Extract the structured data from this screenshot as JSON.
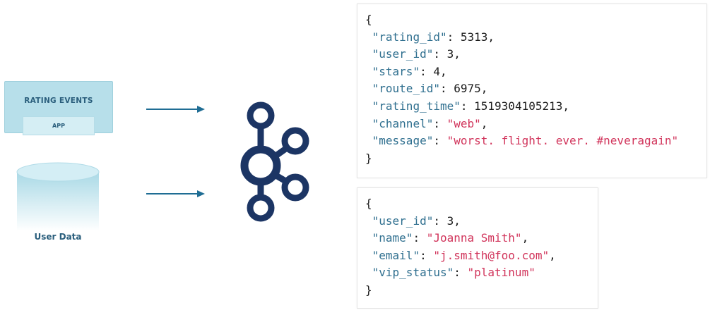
{
  "source": {
    "title": "RATING EVENTS",
    "tag": "APP"
  },
  "database": {
    "label": "User Data"
  },
  "logo": {
    "icon": "kafka-icon"
  },
  "rating_json": {
    "open": "{",
    "close": "}",
    "fields": [
      {
        "key": "\"rating_id\"",
        "value": "5313",
        "type": "number",
        "comma": ","
      },
      {
        "key": "\"user_id\"",
        "value": "3",
        "type": "number",
        "comma": ","
      },
      {
        "key": "\"stars\"",
        "value": "4",
        "type": "number",
        "comma": ","
      },
      {
        "key": "\"route_id\"",
        "value": "6975",
        "type": "number",
        "comma": ","
      },
      {
        "key": "\"rating_time\"",
        "value": "1519304105213",
        "type": "number",
        "comma": ","
      },
      {
        "key": "\"channel\"",
        "value": "\"web\"",
        "type": "string",
        "comma": ","
      },
      {
        "key": "\"message\"",
        "value": "\"worst. flight. ever. #neveragain\"",
        "type": "string",
        "comma": ""
      }
    ]
  },
  "user_json": {
    "open": "{",
    "close": "}",
    "fields": [
      {
        "key": "\"user_id\"",
        "value": "3",
        "type": "number",
        "comma": ","
      },
      {
        "key": "\"name\"",
        "value": "\"Joanna Smith\"",
        "type": "string",
        "comma": ","
      },
      {
        "key": "\"email\"",
        "value": "\"j.smith@foo.com\"",
        "type": "string",
        "comma": ","
      },
      {
        "key": "\"vip_status\"",
        "value": "\"platinum\"",
        "type": "string",
        "comma": ""
      }
    ]
  },
  "colors": {
    "key": "#2f6f8f",
    "string": "#d1345b",
    "logo": "#1c3564",
    "arrow": "#1f6d94"
  }
}
